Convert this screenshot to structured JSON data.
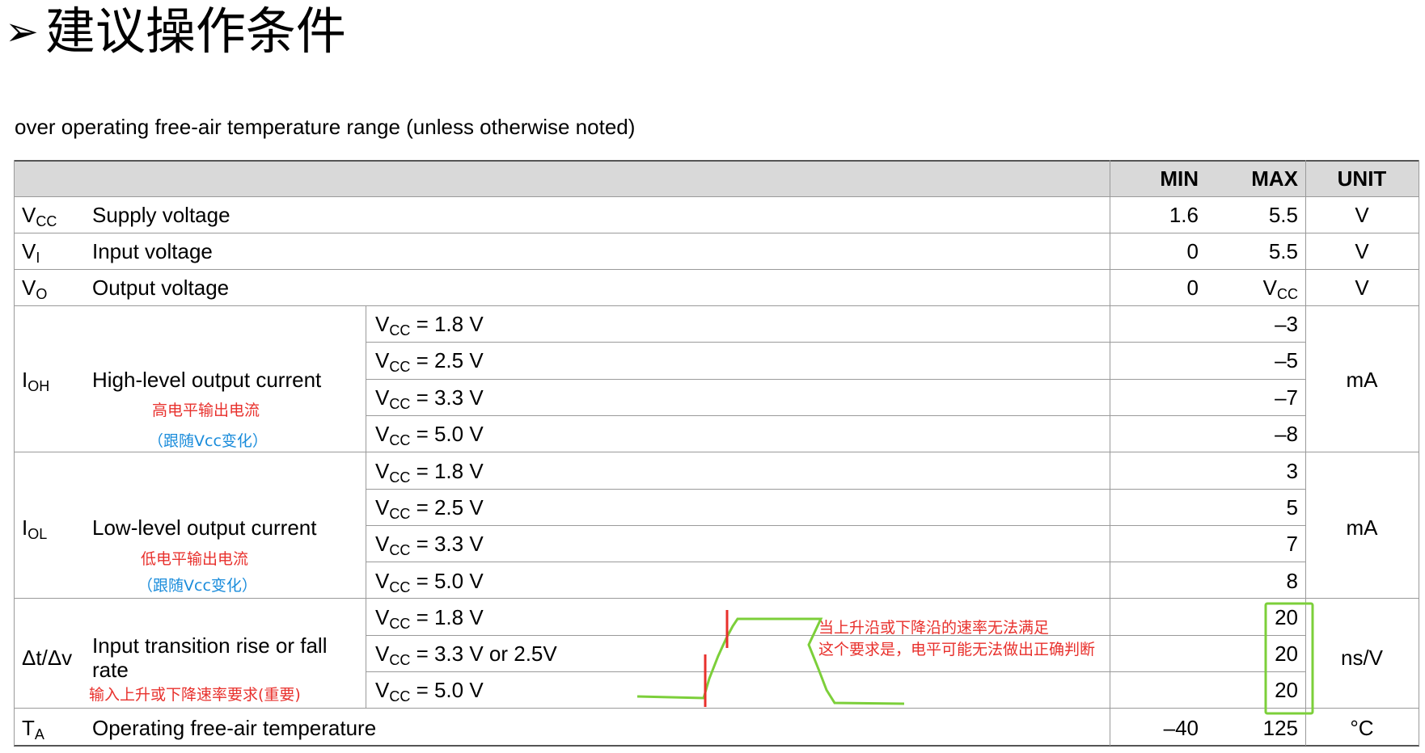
{
  "title": "建议操作条件",
  "subtitle": "over operating free-air temperature range (unless otherwise noted)",
  "header": {
    "min": "MIN",
    "max": "MAX",
    "unit": "UNIT"
  },
  "rows": {
    "vcc": {
      "sym": "V",
      "sub": "CC",
      "param": "Supply voltage",
      "min": "1.6",
      "max": "5.5",
      "unit": "V"
    },
    "vi": {
      "sym": "V",
      "sub": "I",
      "param": "Input voltage",
      "min": "0",
      "max": "5.5",
      "unit": "V"
    },
    "vo": {
      "sym": "V",
      "sub": "O",
      "param": "Output voltage",
      "min": "0",
      "max_sym": "V",
      "max_sub": "CC",
      "unit": "V"
    },
    "ioh": {
      "sym": "I",
      "sub": "OH",
      "param": "High-level output current",
      "unit": "mA",
      "note1": "高电平输出电流",
      "note2": "（跟随Vcc变化）",
      "conds": [
        {
          "v": "V",
          "s": "CC",
          "t": " = 1.8 V",
          "max": "–3"
        },
        {
          "v": "V",
          "s": "CC",
          "t": " = 2.5 V",
          "max": "–5"
        },
        {
          "v": "V",
          "s": "CC",
          "t": " = 3.3 V",
          "max": "–7"
        },
        {
          "v": "V",
          "s": "CC",
          "t": " = 5.0 V",
          "max": "–8"
        }
      ]
    },
    "iol": {
      "sym": "I",
      "sub": "OL",
      "param": "Low-level output current",
      "unit": "mA",
      "note1": "低电平输出电流",
      "note2": "（跟随Vcc变化）",
      "conds": [
        {
          "v": "V",
          "s": "CC",
          "t": " = 1.8 V",
          "max": "3"
        },
        {
          "v": "V",
          "s": "CC",
          "t": " = 2.5 V",
          "max": "5"
        },
        {
          "v": "V",
          "s": "CC",
          "t": " = 3.3 V",
          "max": "7"
        },
        {
          "v": "V",
          "s": "CC",
          "t": " = 5.0 V",
          "max": "8"
        }
      ]
    },
    "dtdv": {
      "sym": "Δt/Δv",
      "param1": "Input transition rise or fall",
      "param2": "rate",
      "unit": "ns/V",
      "note": "输入上升或下降速率要求(重要)",
      "callout1": "当上升沿或下降沿的速率无法满足",
      "callout2": "这个要求是，电平可能无法做出正确判断",
      "conds": [
        {
          "v": "V",
          "s": "CC",
          "t": " = 1.8 V",
          "max": "20"
        },
        {
          "v": "V",
          "s": "CC",
          "t": " = 3.3 V or 2.5V",
          "max": "20"
        },
        {
          "v": "V",
          "s": "CC",
          "t": " = 5.0 V",
          "max": "20"
        }
      ]
    },
    "ta": {
      "sym": "T",
      "sub": "A",
      "param": "Operating free-air temperature",
      "min": "–40",
      "max": "125",
      "unit": "°C"
    }
  },
  "colors": {
    "annotation_red": "#e8302c",
    "annotation_blue": "#1a8cdb",
    "highlight_green": "#7ccf3a",
    "header_bg": "#d9d9d9"
  }
}
